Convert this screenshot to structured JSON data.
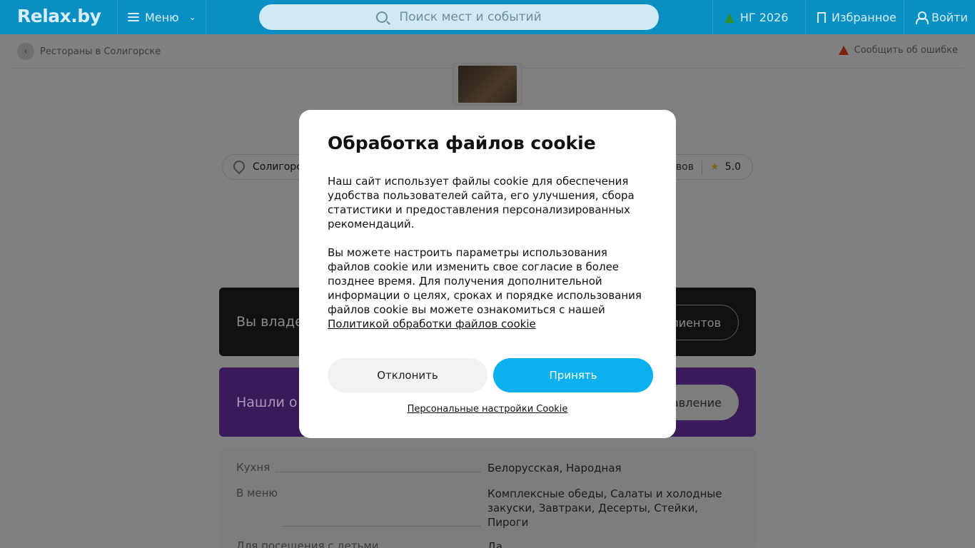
{
  "header": {
    "logo": "Relax.by",
    "menu_label": "Меню",
    "search_placeholder": "Поиск мест и событий",
    "ng_label": "НГ 2026",
    "favorites_label": "Избранное",
    "login_label": "Войти"
  },
  "breadcrumb": {
    "label": "Рестораны в Солигорске"
  },
  "report": {
    "label": "Сообщить об ошибке"
  },
  "info": {
    "city": "Солигорск",
    "reviews": "вов",
    "rating": "5.0"
  },
  "owner_banner": {
    "text": "Вы владе",
    "button": "лиентов"
  },
  "mistake_banner": {
    "text": "Нашли о",
    "button": "авление"
  },
  "details": {
    "rows": [
      {
        "label": "Кухня",
        "value": "Белорусская, Народная"
      },
      {
        "label": "В меню",
        "value": "Комплексные обеды, Салаты и холодные закуски, Завтраки, Десерты, Стейки, Пироги"
      },
      {
        "label": "Для посещения с детьми",
        "value": "Да"
      }
    ]
  },
  "cookie_modal": {
    "title": "Обработка файлов cookie",
    "paragraph1": "Наш сайт использует файлы cookie для обеспечения удобства пользователей сайта, его улучшения, сбора статистики и предоставления персонализированных рекомендаций.",
    "paragraph2": "Вы можете настроить параметры использования файлов cookie или изменить свое согласие в более позднее время. Для получения дополнительной информации о целях, сроках и порядке использования файлов cookie вы можете ознакомиться с нашей",
    "policy_link": "Политикой обработки файлов cookie",
    "decline": "Отклонить",
    "accept": "Принять",
    "personal_settings": "Персональные настройки Cookie"
  },
  "colors": {
    "header_bg": "#0a8fc2",
    "accept_bg": "#0bb0ee",
    "overlay": "#808080"
  }
}
